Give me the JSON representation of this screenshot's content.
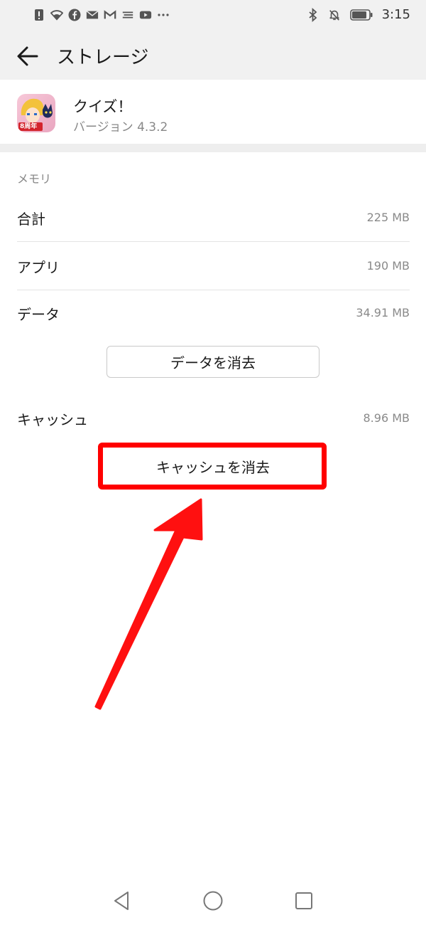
{
  "status_bar": {
    "time": "3:15",
    "left_icons": [
      "alert-icon",
      "wifi-icon",
      "facebook-icon",
      "mail-icon",
      "gmail-icon",
      "notes-icon",
      "youtube-icon",
      "more-icon"
    ],
    "right_icons": [
      "bluetooth-icon",
      "mute-icon",
      "battery-icon"
    ]
  },
  "header": {
    "title": "ストレージ"
  },
  "app": {
    "name": "クイズ！",
    "version": "バージョン 4.3.2",
    "icon_badge": "8周年"
  },
  "memory": {
    "section_title": "メモリ",
    "total": {
      "label": "合計",
      "value": "225 MB"
    },
    "app": {
      "label": "アプリ",
      "value": "190 MB"
    },
    "data": {
      "label": "データ",
      "value": "34.91 MB"
    },
    "clear_data_label": "データを消去",
    "cache": {
      "label": "キャッシュ",
      "value": "8.96 MB"
    },
    "clear_cache_label": "キャッシュを消去"
  },
  "annotation": {
    "highlight_color": "#ff0000",
    "arrow_color": "#ff0000"
  },
  "nav": {
    "icons": [
      "back-triangle-icon",
      "home-circle-icon",
      "recents-square-icon"
    ]
  }
}
